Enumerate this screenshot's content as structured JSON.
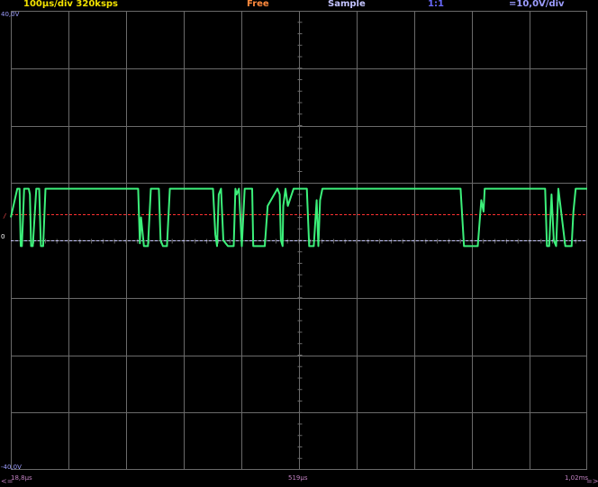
{
  "header": {
    "timebase": "100µs/div  320ksps",
    "trigger_mode": "Free",
    "acquisition": "Sample",
    "ratio": "1:1",
    "volts_div": "=10,0V/div"
  },
  "axis": {
    "y_top": "40,0V",
    "y_bottom": "-40,0V",
    "zero_marker": "0",
    "trigger_marker": "/",
    "x_left": "18,8µs",
    "x_mid": "519µs",
    "x_right": "1,02ms",
    "arrow_left": "<=",
    "arrow_right": "=>"
  },
  "colors": {
    "grid": "#6a6a6a",
    "trace": "#3cf07a",
    "trigger_line": "#ff3030",
    "zero_line": "#c8c8ff"
  },
  "chart_data": {
    "type": "line",
    "xlabel": "",
    "ylabel": "",
    "ylim": [
      -40,
      40
    ],
    "xlim": [
      18.8,
      1020
    ],
    "grid": true,
    "trigger_level": 4.5,
    "zero_level": 0,
    "series": [
      {
        "x": [
          18.8,
          30,
          34,
          36,
          38,
          42,
          45,
          50,
          52,
          54,
          57,
          63,
          68,
          71,
          75,
          79,
          240,
          243,
          245,
          250,
          257,
          262,
          276,
          279,
          283,
          288,
          290,
          295,
          313,
          344,
          370,
          374,
          377,
          380,
          384,
          388,
          396,
          400,
          406,
          409,
          411,
          415,
          420,
          425,
          438,
          440,
          445,
          460,
          465,
          482,
          486,
          488,
          491,
          492,
          496,
          500,
          510,
          530,
          533,
          537,
          545,
          550,
          553,
          556,
          560,
          564,
          612,
          800,
          806,
          810,
          820,
          830,
          836,
          840,
          842,
          845,
          850,
          947,
          950,
          954,
          958,
          962,
          966,
          970,
          982,
          990,
          993,
          996,
          1000,
          1005,
          1020
        ],
        "values": [
          4,
          9,
          9,
          -1,
          -1,
          9,
          9,
          9,
          8,
          -1,
          -1,
          9,
          9,
          -1,
          -1,
          9,
          9,
          -0.5,
          4,
          -1,
          -1,
          9,
          9,
          0,
          -1,
          -1,
          -1,
          9,
          9,
          9,
          9,
          1,
          -1,
          8,
          9,
          0,
          -1,
          -1,
          -1,
          9,
          8,
          9,
          -1,
          9,
          9,
          -1,
          -1,
          -1,
          6,
          9,
          8,
          0,
          -1,
          6,
          9,
          6,
          9,
          9,
          9,
          -1,
          -1,
          7,
          -1,
          7,
          9,
          9,
          9,
          9,
          -1,
          -1,
          -1,
          -1,
          7,
          5,
          9,
          9,
          9,
          9,
          -1,
          -1,
          8,
          0,
          -1,
          9,
          -1,
          -1,
          -1,
          5,
          9,
          9,
          9
        ]
      }
    ]
  }
}
